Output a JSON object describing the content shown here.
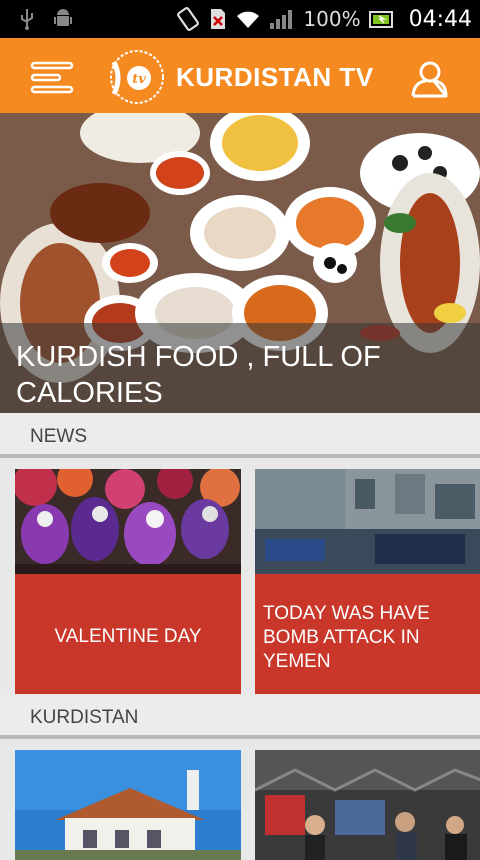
{
  "status_bar": {
    "battery_percent": "100%",
    "time": "04:44",
    "icons": [
      "usb-icon",
      "android-icon",
      "rotate-icon",
      "no-sim-icon",
      "wifi-icon",
      "signal-icon",
      "battery-icon"
    ]
  },
  "app_bar": {
    "title": "KURDISTAN TV",
    "logo_letters": "tv",
    "colors": {
      "accent": "#f58a21",
      "card_red": "#c8372a"
    }
  },
  "featured": {
    "title": "KURDISH FOOD , FULL OF CALORIES"
  },
  "sections": [
    {
      "label": "NEWS",
      "items": [
        {
          "title": "VALENTINE DAY"
        },
        {
          "title": "TODAY WAS HAVE BOMB ATTACK IN YEMEN"
        }
      ]
    },
    {
      "label": "KURDISTAN"
    }
  ]
}
